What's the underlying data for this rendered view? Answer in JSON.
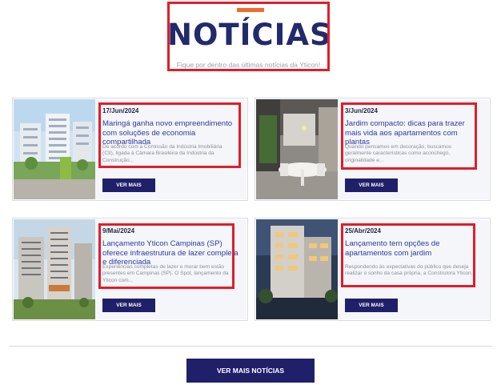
{
  "header": {
    "title": "NOTÍCIAS",
    "subtitle": "Fique por dentro das últimas notícias da Yticon!"
  },
  "colors": {
    "accent": "#ee6d2a",
    "brand": "#222a6b",
    "button": "#20206a",
    "highlight": "#e11d2a"
  },
  "news": [
    {
      "date": "17/Jun/2024",
      "title": "Maringá ganha novo empreendimento com soluções de economia compartilhada",
      "excerpt": "De acordo com a Comissão da Indústria Imobiliária (CII), ligada à Câmara Brasileira da Indústria da Construção...",
      "button": "VER MAIS"
    },
    {
      "date": "3/Jun/2024",
      "title": "Jardim compacto: dicas para trazer mais vida aos apartamentos com plantas",
      "excerpt": "Quando pensamos em decoração, buscamos geralmente características como aconchego, originalidade e...",
      "button": "VER MAIS"
    },
    {
      "date": "9/Mai/2024",
      "title": "Lançamento Yticon Campinas (SP) oferece infraestrutura de lazer completa e diferenciada",
      "excerpt": "Experiências completas de lazer e morar bem estão presentes em Campinas (SP). O Spot, lançamento da Yticon com...",
      "button": "VER MAIS"
    },
    {
      "date": "25/Abr/2024",
      "title": "Lançamento tem opções de apartamentos com jardim",
      "excerpt": "Respondendo às expectativas do público que deseja realizar o sonho da casa própria, a Construtora Yticon...",
      "button": "VER MAIS"
    }
  ],
  "footer": {
    "more_button": "VER MAIS NOTÍCIAS"
  }
}
